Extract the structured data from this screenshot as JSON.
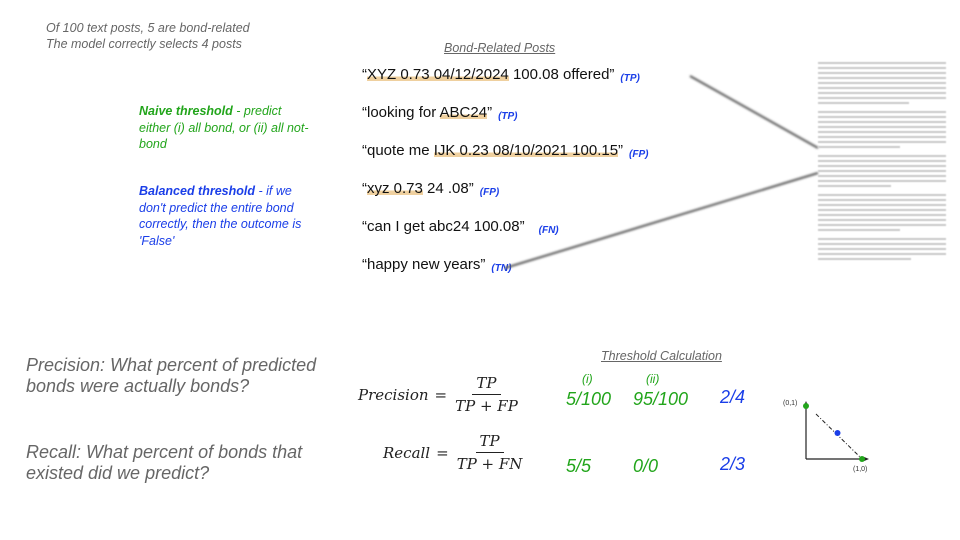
{
  "intro": {
    "line1": "Of 100 text posts, 5 are bond-related",
    "line2": "The model correctly selects 4 posts"
  },
  "notes": {
    "naive": {
      "title": "Naive threshold",
      "text": " - predict either (i) all bond, or (ii) all not-bond",
      "color": "#22a51b"
    },
    "balanced": {
      "title": "Balanced threshold",
      "text": " - if we don't predict the entire bond correctly, then the outcome is 'False'",
      "color": "#1a3ee8"
    }
  },
  "posts": {
    "title": "Bond-Related Posts",
    "items": [
      {
        "pre": "“",
        "highlight": "XYZ 0.73 04/12/2024",
        "post": " 100.08 offered”",
        "tag": "(TP)"
      },
      {
        "pre": "“looking for ",
        "highlight": "ABC24",
        "post": "”",
        "tag": "(TP)"
      },
      {
        "pre": "“quote me ",
        "highlight": "IJK 0.23 08/10/2021 100.15",
        "post": "”",
        "tag": "(FP)"
      },
      {
        "pre": "“",
        "highlight": "xyz 0.73",
        "post": " 24  .08”",
        "tag": "(FP)"
      },
      {
        "pre": "“can I get abc24 100.08”",
        "highlight": "",
        "post": "",
        "tag": "(FN)"
      },
      {
        "pre": "“happy new years”",
        "highlight": "",
        "post": "",
        "tag": "(TN)"
      }
    ]
  },
  "questions": {
    "precision": "Precision: What percent of predicted bonds were actually bonds?",
    "recall": "Recall: What percent of bonds that existed did we predict?"
  },
  "formulas": {
    "precision": {
      "lhs": "Precision",
      "eq": "=",
      "num": "TP",
      "den": "TP + FP"
    },
    "recall": {
      "lhs": "Recall",
      "eq": "=",
      "num": "TP",
      "den": "TP + FN"
    }
  },
  "threshold": {
    "title": "Threshold Calculation",
    "col_labels": [
      "(i)",
      "(ii)"
    ],
    "precision": {
      "naive_i": "5/100",
      "naive_ii": "95/100",
      "balanced": "2/4"
    },
    "recall": {
      "naive_i": "5/5",
      "naive_ii": "0/0",
      "balanced": "2/3"
    }
  },
  "pr_plot": {
    "label_top": "(0,1)",
    "label_right": "(1,0)",
    "colors": {
      "endpoints": "#22a51b",
      "midpoint": "#1a3ee8"
    }
  }
}
